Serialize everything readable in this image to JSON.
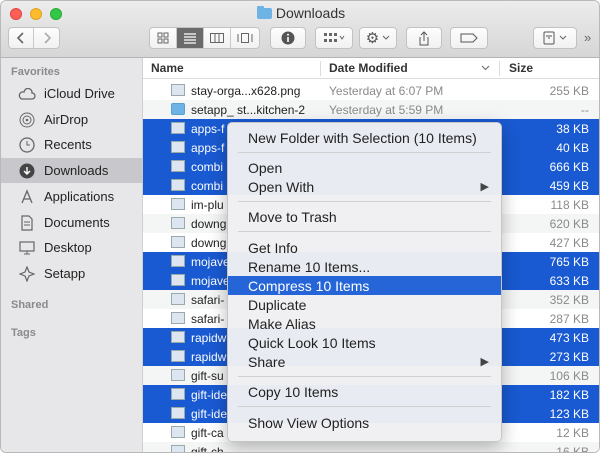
{
  "window": {
    "title": "Downloads"
  },
  "toolbar": {
    "back_icon": "chevron-left-icon",
    "forward_icon": "chevron-right-icon",
    "view_icons": [
      "icon-view-icon",
      "list-view-icon",
      "column-view-icon",
      "gallery-view-icon"
    ],
    "info_icon": "info-icon",
    "group_icon": "group-icon",
    "action_icon": "gear-icon",
    "share_icon": "share-icon",
    "tag_icon": "tag-icon",
    "extra_icon": "dropbox-icon",
    "more_icon": "chevron-double-right-icon"
  },
  "sidebar": {
    "favorites_label": "Favorites",
    "shared_label": "Shared",
    "tags_label": "Tags",
    "items": [
      {
        "label": "iCloud Drive",
        "icon": "cloud-icon"
      },
      {
        "label": "AirDrop",
        "icon": "airdrop-icon"
      },
      {
        "label": "Recents",
        "icon": "clock-icon"
      },
      {
        "label": "Downloads",
        "icon": "download-icon"
      },
      {
        "label": "Applications",
        "icon": "applications-icon"
      },
      {
        "label": "Documents",
        "icon": "document-icon"
      },
      {
        "label": "Desktop",
        "icon": "desktop-icon"
      },
      {
        "label": "Setapp",
        "icon": "setapp-icon"
      }
    ]
  },
  "columns": {
    "name": "Name",
    "date": "Date Modified",
    "size": "Size"
  },
  "files": [
    {
      "name": "stay-orga...x628.png",
      "date": "Yesterday at 6:07 PM",
      "size": "255 KB"
    },
    {
      "name": "setapp_ st...kitchen-2",
      "date": "Yesterday at 5:59 PM",
      "size": "--"
    },
    {
      "name": "apps-f",
      "date": "",
      "size": "38 KB"
    },
    {
      "name": "apps-f",
      "date": "",
      "size": "40 KB"
    },
    {
      "name": "combi",
      "date": "",
      "size": "666 KB"
    },
    {
      "name": "combi",
      "date": "",
      "size": "459 KB"
    },
    {
      "name": "im-plu",
      "date": "",
      "size": "118 KB"
    },
    {
      "name": "downg",
      "date": "",
      "size": "620 KB"
    },
    {
      "name": "downg",
      "date": "",
      "size": "427 KB"
    },
    {
      "name": "mojave",
      "date": "",
      "size": "765 KB"
    },
    {
      "name": "mojave",
      "date": "",
      "size": "633 KB"
    },
    {
      "name": "safari-",
      "date": "",
      "size": "352 KB"
    },
    {
      "name": "safari-",
      "date": "",
      "size": "287 KB"
    },
    {
      "name": "rapidw",
      "date": "",
      "size": "473 KB"
    },
    {
      "name": "rapidw",
      "date": "",
      "size": "273 KB"
    },
    {
      "name": "gift-su",
      "date": "",
      "size": "106 KB"
    },
    {
      "name": "gift-ide",
      "date": "",
      "size": "182 KB"
    },
    {
      "name": "gift-ide",
      "date": "",
      "size": "123 KB"
    },
    {
      "name": "gift-ca",
      "date": "",
      "size": "12 KB"
    },
    {
      "name": "gift-ch",
      "date": "",
      "size": "16 KB"
    }
  ],
  "menu": {
    "new_folder": "New Folder with Selection (10 Items)",
    "open": "Open",
    "open_with": "Open With",
    "move_to_trash": "Move to Trash",
    "get_info": "Get Info",
    "rename": "Rename 10 Items...",
    "compress": "Compress 10 Items",
    "duplicate": "Duplicate",
    "make_alias": "Make Alias",
    "quick_look": "Quick Look 10 Items",
    "share": "Share",
    "copy": "Copy 10 Items",
    "show_view_options": "Show View Options",
    "submenu_arrow": "▶"
  },
  "colors": {
    "selection": "#1959d1",
    "menu_highlight": "#2565d8"
  }
}
